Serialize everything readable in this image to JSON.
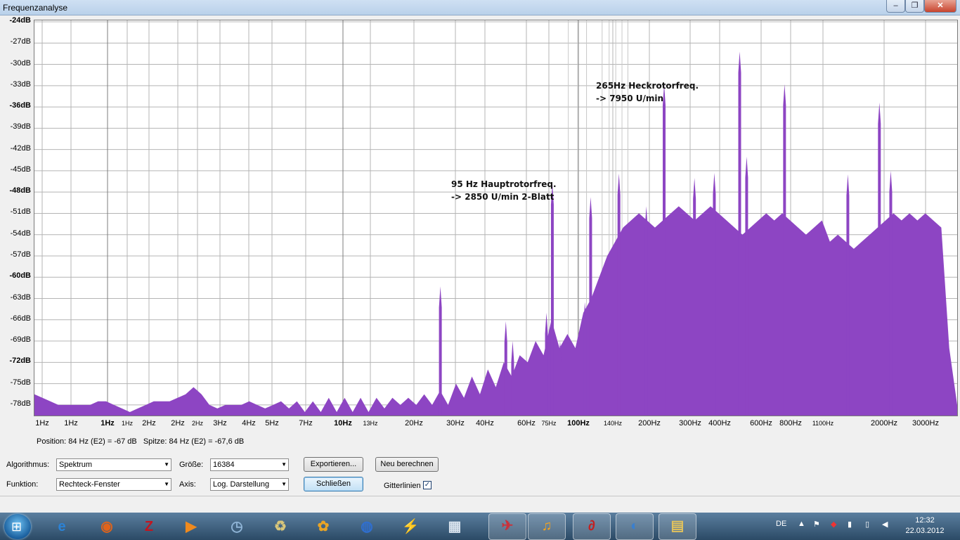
{
  "window": {
    "title": "Frequenzanalyse",
    "min": "–",
    "max": "❐",
    "close": "✕"
  },
  "chart_data": {
    "type": "area",
    "title": "",
    "xlabel": "",
    "ylabel": "",
    "xscale": "log",
    "ylim": [
      -79.5,
      -23.8
    ],
    "xlim": [
      0.82,
      3900
    ],
    "color": "#8d45c3",
    "grid": true,
    "y_ticks": [
      {
        "v": -24,
        "l": "-24dB",
        "b": true
      },
      {
        "v": -27,
        "l": "-27dB",
        "b": false
      },
      {
        "v": -30,
        "l": "-30dB",
        "b": false
      },
      {
        "v": -33,
        "l": "-33dB",
        "b": false
      },
      {
        "v": -36,
        "l": "-36dB",
        "b": true
      },
      {
        "v": -39,
        "l": "-39dB",
        "b": false
      },
      {
        "v": -42,
        "l": "-42dB",
        "b": false
      },
      {
        "v": -45,
        "l": "-45dB",
        "b": false
      },
      {
        "v": -48,
        "l": "-48dB",
        "b": true
      },
      {
        "v": -51,
        "l": "-51dB",
        "b": false
      },
      {
        "v": -54,
        "l": "-54dB",
        "b": false
      },
      {
        "v": -57,
        "l": "-57dB",
        "b": false
      },
      {
        "v": -60,
        "l": "-60dB",
        "b": true
      },
      {
        "v": -63,
        "l": "-63dB",
        "b": false
      },
      {
        "v": -66,
        "l": "-66dB",
        "b": false
      },
      {
        "v": -69,
        "l": "-69dB",
        "b": false
      },
      {
        "v": -72,
        "l": "-72dB",
        "b": true
      },
      {
        "v": -75,
        "l": "-75dB",
        "b": false
      },
      {
        "v": -78,
        "l": "-78dB",
        "b": false
      }
    ],
    "x_tick_labels": [
      {
        "l": "1Hz",
        "px": 60,
        "s": "n"
      },
      {
        "l": "1Hz",
        "px": 101,
        "s": "n"
      },
      {
        "l": "1Hz",
        "px": 153,
        "s": "b"
      },
      {
        "l": "1Hz",
        "px": 181,
        "s": "s"
      },
      {
        "l": "2Hz",
        "px": 212,
        "s": "n"
      },
      {
        "l": "2Hz",
        "px": 253,
        "s": "n"
      },
      {
        "l": "2Hz",
        "px": 281,
        "s": "s"
      },
      {
        "l": "3Hz",
        "px": 313,
        "s": "n"
      },
      {
        "l": "4Hz",
        "px": 354,
        "s": "n"
      },
      {
        "l": "5Hz",
        "px": 387,
        "s": "n"
      },
      {
        "l": "7Hz",
        "px": 435,
        "s": "n"
      },
      {
        "l": "10Hz",
        "px": 488,
        "s": "b"
      },
      {
        "l": "13Hz",
        "px": 527,
        "s": "s"
      },
      {
        "l": "20Hz",
        "px": 589,
        "s": "n"
      },
      {
        "l": "30Hz",
        "px": 648,
        "s": "n"
      },
      {
        "l": "40Hz",
        "px": 690,
        "s": "n"
      },
      {
        "l": "60Hz",
        "px": 749,
        "s": "n"
      },
      {
        "l": "75Hz",
        "px": 781,
        "s": "s"
      },
      {
        "l": "100Hz",
        "px": 823,
        "s": "b"
      },
      {
        "l": "140Hz",
        "px": 872,
        "s": "s"
      },
      {
        "l": "200Hz",
        "px": 924,
        "s": "n"
      },
      {
        "l": "300Hz",
        "px": 982,
        "s": "n"
      },
      {
        "l": "400Hz",
        "px": 1024,
        "s": "n"
      },
      {
        "l": "600Hz",
        "px": 1083,
        "s": "n"
      },
      {
        "l": "800Hz",
        "px": 1125,
        "s": "n"
      },
      {
        "l": "1100Hz",
        "px": 1171,
        "s": "s"
      },
      {
        "l": "2000Hz",
        "px": 1258,
        "s": "n"
      },
      {
        "l": "3000Hz",
        "px": 1317,
        "s": "n"
      }
    ],
    "spectrum_db": [
      -76.5,
      -77,
      -77.5,
      -78,
      -78,
      -78,
      -78,
      -78,
      -77.5,
      -77.5,
      -78,
      -78.5,
      -79,
      -78.5,
      -78,
      -77.5,
      -77.5,
      -77.5,
      -77,
      -76.5,
      -75.5,
      -76.5,
      -78,
      -78.5,
      -78,
      -78,
      -78,
      -77.5,
      -78,
      -78.5,
      -78,
      -77.5,
      -78.5,
      -77.5,
      -79,
      -77.5,
      -79,
      -77,
      -79,
      -77,
      -79,
      -77,
      -79,
      -77,
      -78.5,
      -77,
      -78,
      -77,
      -78,
      -76.5,
      -78,
      -76,
      -78,
      -75,
      -77,
      -74,
      -76.5,
      -73,
      -75.5,
      -72,
      -74,
      -71,
      -72,
      -69,
      -71,
      -66,
      -70,
      -68,
      -70,
      -65,
      -63,
      -60,
      -57,
      -55,
      -53,
      -52,
      -51,
      -52,
      -53,
      -52,
      -51,
      -50,
      -51,
      -52,
      -51,
      -50,
      -51,
      -52,
      -53,
      -54,
      -53,
      -52,
      -51,
      -52,
      -51,
      -52,
      -53,
      -54,
      -53,
      -52,
      -55,
      -54,
      -55,
      -56,
      -55,
      -54,
      -53,
      -52,
      -51,
      -52,
      -51,
      -52,
      -51,
      -52,
      -53,
      -70,
      -78
    ],
    "spectrum_start": 0.82,
    "spectrum_end": 3900,
    "peaks": [
      {
        "f": 34,
        "db": -61.3
      },
      {
        "f": 62,
        "db": -66.2
      },
      {
        "f": 66,
        "db": -69
      },
      {
        "f": 90,
        "db": -65
      },
      {
        "f": 95,
        "db": -46.8
      },
      {
        "f": 102,
        "db": -69
      },
      {
        "f": 128,
        "db": -63.5
      },
      {
        "f": 135,
        "db": -48.7
      },
      {
        "f": 175,
        "db": -45.4
      },
      {
        "f": 225,
        "db": -50
      },
      {
        "f": 265,
        "db": -32.8
      },
      {
        "f": 350,
        "db": -46
      },
      {
        "f": 420,
        "db": -45.3
      },
      {
        "f": 530,
        "db": -28.2
      },
      {
        "f": 565,
        "db": -43
      },
      {
        "f": 800,
        "db": -32.8
      },
      {
        "f": 1430,
        "db": -45.5
      },
      {
        "f": 1910,
        "db": -35.4
      },
      {
        "f": 2120,
        "db": -45
      }
    ]
  },
  "annotations": {
    "heck": "265Hz Heckrotorfreq.\n-> 7950 U/min",
    "haupt": "95 Hz Hauptrotorfreq.\n-> 2850 U/min 2-Blatt"
  },
  "status": {
    "position": "Position: 84 Hz (E2) = -67 dB",
    "peak": "Spitze: 84 Hz (E2) = -67,6 dB"
  },
  "controls": {
    "algorithm_label": "Algorithmus:",
    "algorithm_value": "Spektrum",
    "size_label": "Größe:",
    "size_value": "16384",
    "export_button": "Exportieren...",
    "recalc_button": "Neu berechnen",
    "function_label": "Funktion:",
    "function_value": "Rechteck-Fenster",
    "axis_label": "Axis:",
    "axis_value": "Log. Darstellung",
    "close_button": "Schließen",
    "grid_label": "Gitterlinien",
    "grid_checked": "✓"
  },
  "taskbar": {
    "lang": "DE",
    "time": "12:32",
    "date": "22.03.2012",
    "icons": [
      "ie-icon",
      "firefox-icon",
      "filezilla-icon",
      "media-player-icon",
      "clock-gadget-icon",
      "recycle-icon",
      "gadget-icon",
      "globe-icon",
      "tools-icon",
      "window-app-icon",
      "bird-app-icon",
      "audacity-icon",
      "logo-app-icon",
      "network-icon",
      "explorer-icon"
    ]
  }
}
